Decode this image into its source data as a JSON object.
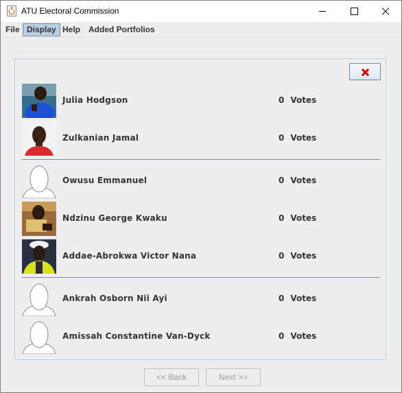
{
  "window": {
    "title": "ATU Electoral Commission"
  },
  "menu": {
    "file": "File",
    "display": "Display",
    "help": "Help",
    "added_portfolios": "Added Portfolios"
  },
  "candidates": [
    {
      "name": "Julia Hodgson",
      "votes": "0",
      "votes_label": "Votes",
      "photo": "person-photo"
    },
    {
      "name": "Zulkanian Jamal",
      "votes": "0",
      "votes_label": "Votes",
      "photo": "person-photo"
    },
    {
      "name": "Owusu Emmanuel",
      "votes": "0",
      "votes_label": "Votes",
      "photo": "default-avatar"
    },
    {
      "name": "Ndzinu George Kwaku",
      "votes": "0",
      "votes_label": "Votes",
      "photo": "person-photo"
    },
    {
      "name": "Addae-Abrokwa Victor Nana",
      "votes": "0",
      "votes_label": "Votes",
      "photo": "person-photo"
    },
    {
      "name": "Ankrah Osborn Nii Ayi",
      "votes": "0",
      "votes_label": "Votes",
      "photo": "default-avatar"
    },
    {
      "name": "Amissah Constantine Van-Dyck",
      "votes": "0",
      "votes_label": "Votes",
      "photo": "default-avatar"
    }
  ],
  "nav": {
    "back": "<< Back",
    "next": "Next >>"
  },
  "colors": {
    "accent": "#b8cfe5",
    "close_icon": "#cc0000",
    "separator": "#7a8aa8"
  }
}
